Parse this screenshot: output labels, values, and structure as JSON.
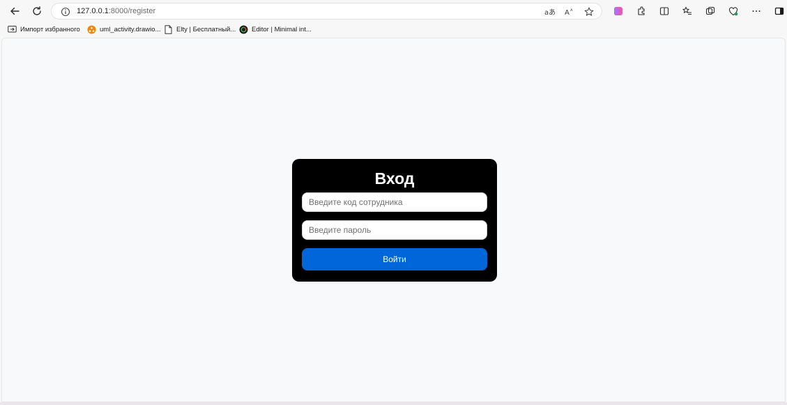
{
  "browser": {
    "url_host": "127.0.0.1",
    "url_path": ":8000/register",
    "bookmarks": [
      {
        "label": "Импорт избранного",
        "icon": "import-favorites-icon"
      },
      {
        "label": "uml_activity.drawio...",
        "icon": "drawio-icon"
      },
      {
        "label": "Elty | Бесплатный...",
        "icon": "page-icon"
      },
      {
        "label": "Editor | Minimal int...",
        "icon": "editor-logo-icon"
      }
    ]
  },
  "login": {
    "title": "Вход",
    "code_placeholder": "Введите код сотрудника",
    "password_placeholder": "Введите пароль",
    "submit_label": "Войти"
  },
  "colors": {
    "card_bg": "#000000",
    "button_bg": "#0066d9",
    "page_bg": "#f8f9fa"
  }
}
